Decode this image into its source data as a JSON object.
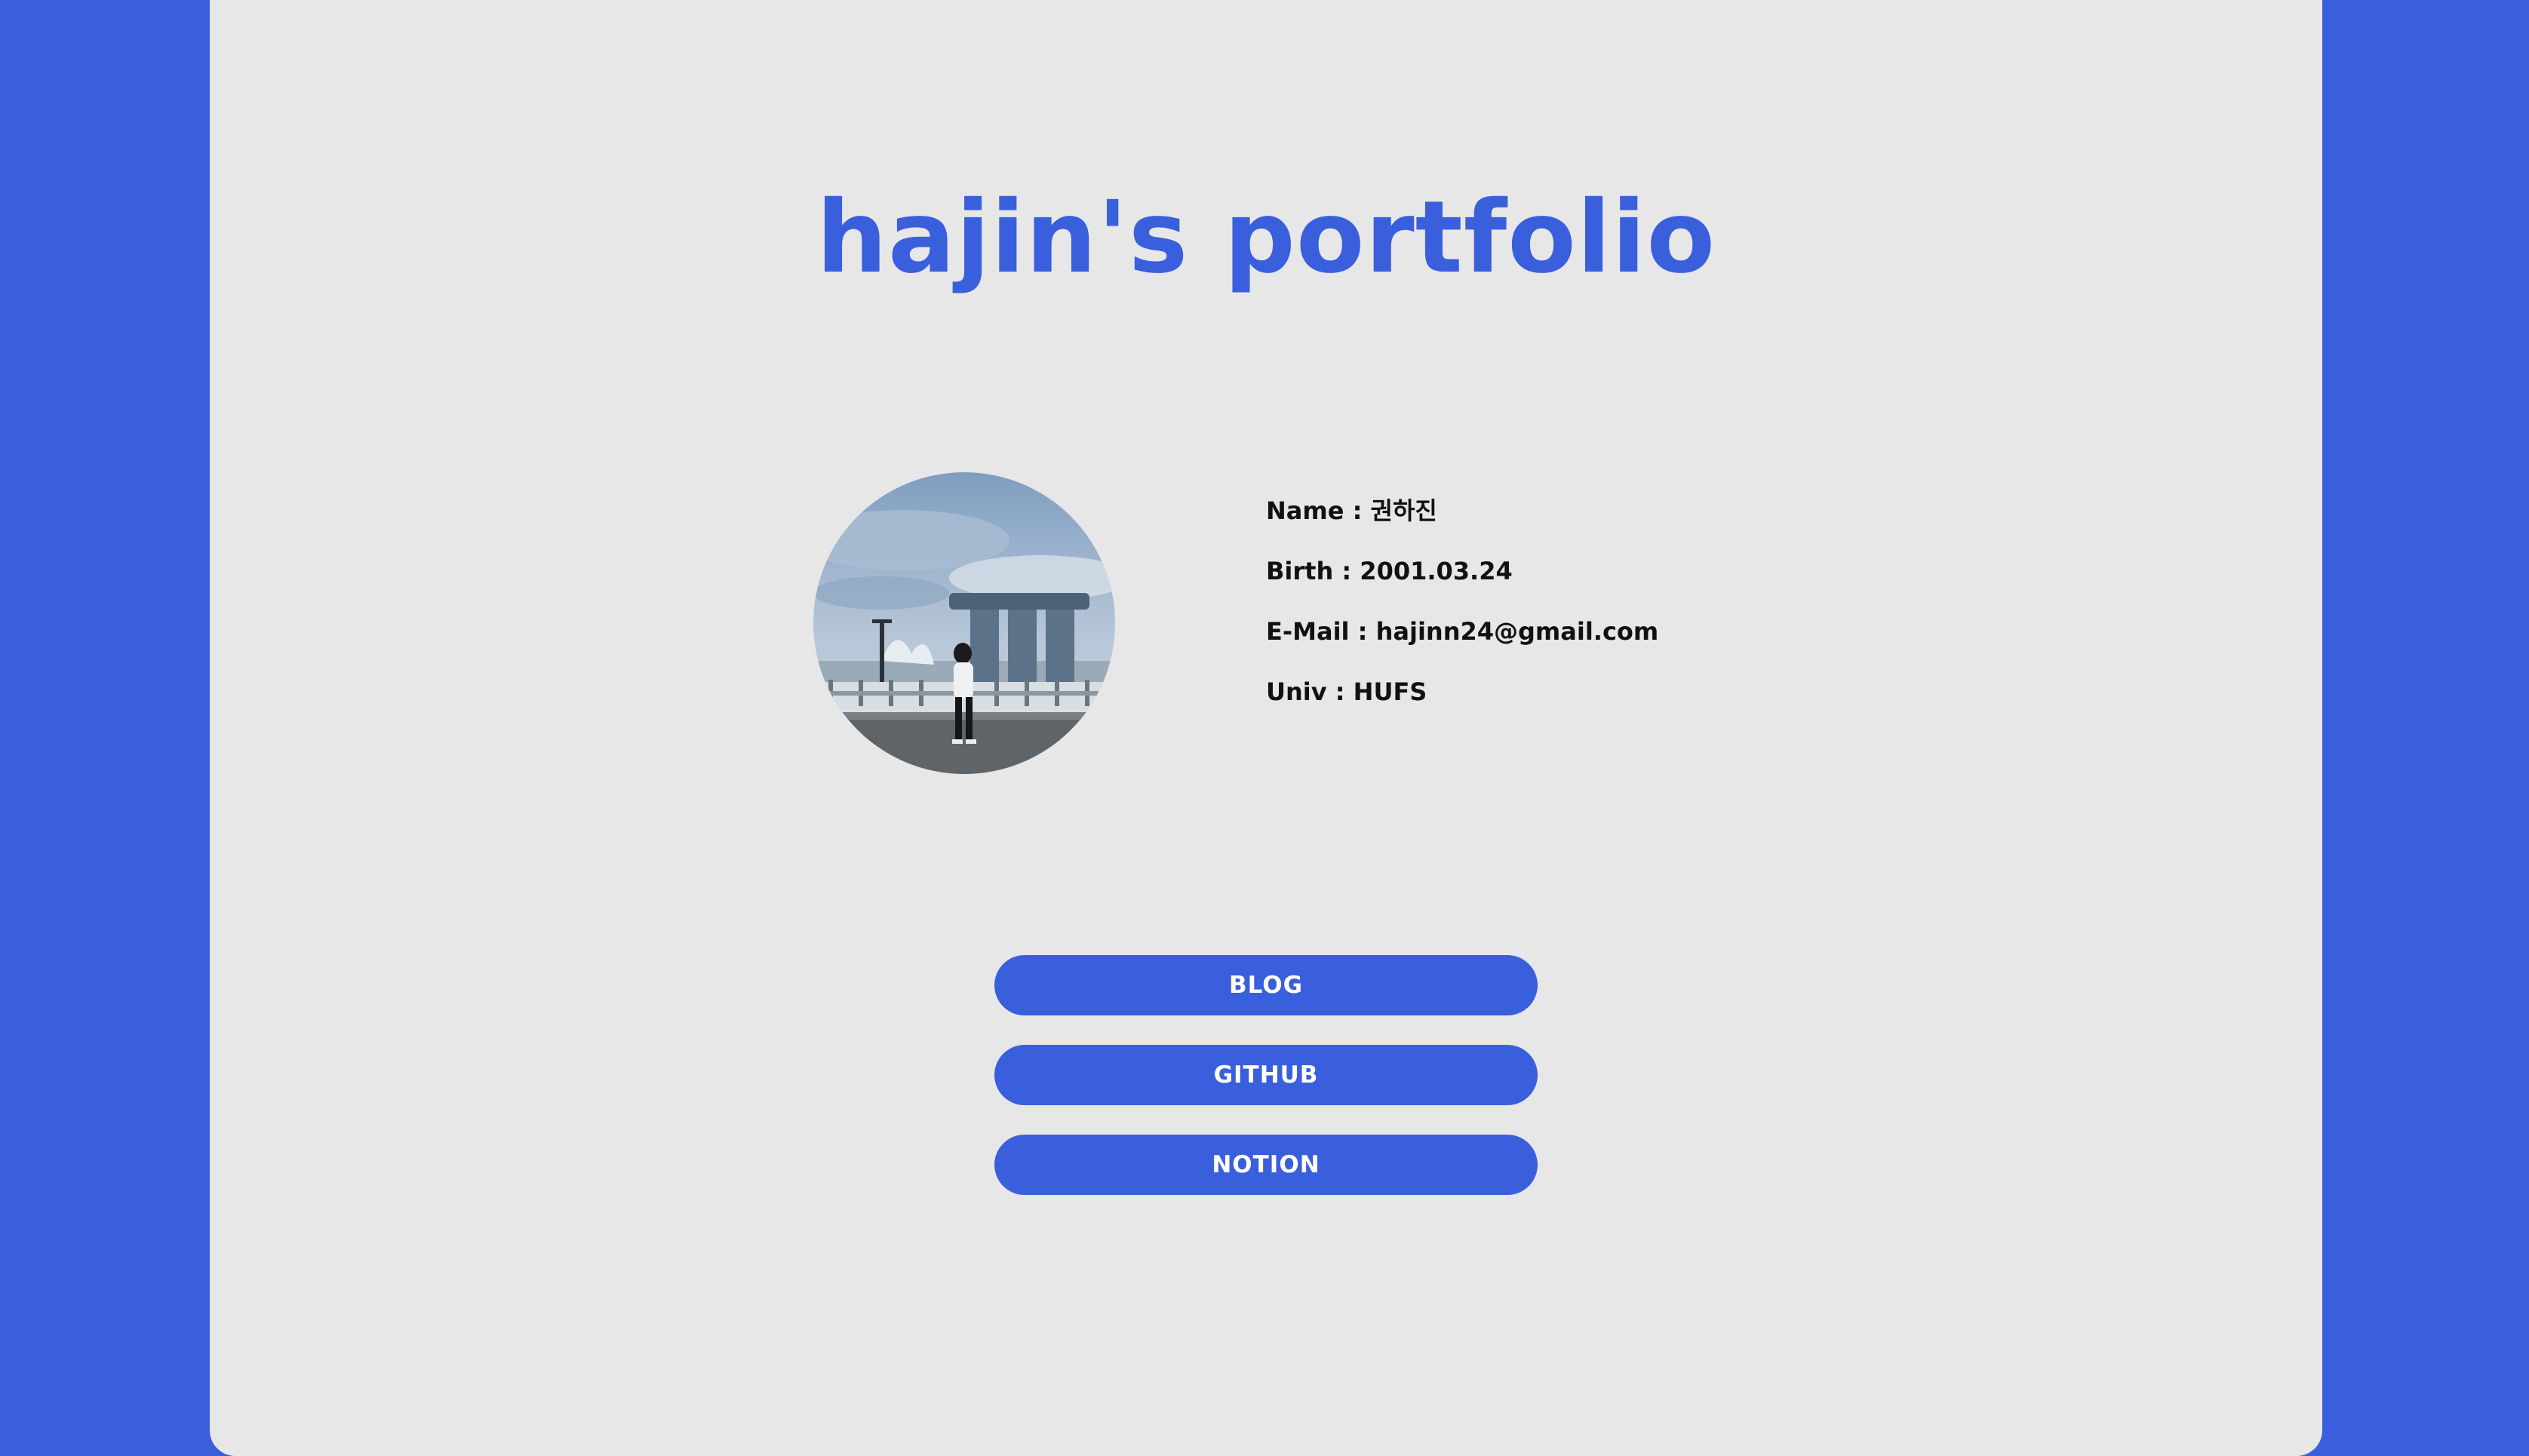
{
  "header": {
    "title": "hajin's portfolio"
  },
  "profile": {
    "name": "Name : 권하진",
    "birth": "Birth : 2001.03.24",
    "email": "E-Mail : hajinn24@gmail.com",
    "univ": "Univ : HUFS"
  },
  "links": {
    "blog": "BLOG",
    "github": "GITHUB",
    "notion": "NOTION"
  },
  "colors": {
    "accent": "#3a5fdc",
    "card_background": "#e7e7e8",
    "text": "#111111",
    "button_text": "#ffffff"
  }
}
